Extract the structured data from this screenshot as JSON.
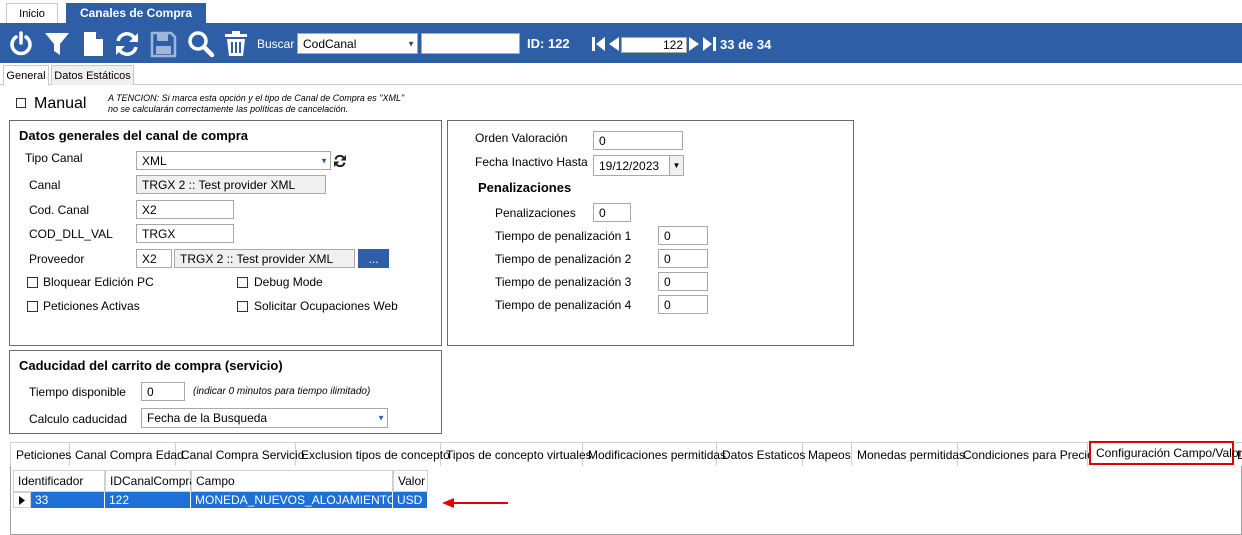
{
  "top_tabs": [
    "Inicio",
    "Canales de Compra"
  ],
  "toolbar": {
    "icons": [
      "power-icon",
      "filter-icon",
      "new-document-icon",
      "refresh-icon",
      "save-icon",
      "search-icon",
      "trash-icon"
    ],
    "search_label": "Buscar",
    "search_field": "CodCanal",
    "id_label": "ID: 122",
    "record_number": "122",
    "record_position": "33 de 34"
  },
  "sub_tabs": [
    "General",
    "Datos Estáticos"
  ],
  "manual": {
    "label": "Manual",
    "warning_line1": "A TENCION: Si marca esta opción y el tipo de Canal de Compra es \"XML\"",
    "warning_line2": "no se calcularán correctamente las políticas de cancelación."
  },
  "general": {
    "title": "Datos generales del canal de compra",
    "tipo_canal_label": "Tipo Canal",
    "tipo_canal_value": "XML",
    "canal_label": "Canal",
    "canal_value": "TRGX 2 :: Test provider XML",
    "cod_canal_label": "Cod. Canal",
    "cod_canal_value": "X2",
    "cod_dll_label": "COD_DLL_VAL",
    "cod_dll_value": "TRGX",
    "proveedor_label": "Proveedor",
    "proveedor_code": "X2",
    "proveedor_name": "TRGX 2 :: Test provider XML",
    "browse_label": "...",
    "bloquear_label": "Bloquear Edición PC",
    "debug_label": "Debug Mode",
    "peticiones_label": "Peticiones Activas",
    "solicitar_label": "Solicitar Ocupaciones Web"
  },
  "right_panel": {
    "orden_label": "Orden Valoración",
    "orden_value": "0",
    "fecha_label": "Fecha Inactivo Hasta",
    "fecha_value": "19/12/2023",
    "penalizaciones_title": "Penalizaciones",
    "penalizaciones_label": "Penalizaciones",
    "penalizaciones_value": "0",
    "tiempo1_label": "Tiempo de penalización 1",
    "tiempo1_value": "0",
    "tiempo2_label": "Tiempo de penalización 2",
    "tiempo2_value": "0",
    "tiempo3_label": "Tiempo de penalización 3",
    "tiempo3_value": "0",
    "tiempo4_label": "Tiempo de penalización 4",
    "tiempo4_value": "0"
  },
  "caducidad": {
    "title": "Caducidad del carrito de compra (servicio)",
    "tiempo_label": "Tiempo disponible",
    "tiempo_value": "0",
    "tiempo_hint": "(indicar 0 minutos para tiempo ilimitado)",
    "calculo_label": "Calculo caducidad",
    "calculo_value": "Fecha de la Busqueda"
  },
  "bottom_tabs": [
    "Peticiones",
    "Canal Compra Edad",
    "Canal Compra Servicio",
    "Exclusion tipos de concepto",
    "Tipos de concepto virtuales",
    "Modificaciones permitidas",
    "Datos Estaticos",
    "Mapeos",
    "Monedas permitidas",
    "Condiciones para Precios",
    "Configuración Campo/Valor",
    "L"
  ],
  "grid": {
    "columns": [
      "Identificador",
      "IDCanalCompra",
      "Campo",
      "Valor"
    ],
    "rows": [
      [
        "33",
        "122",
        "MONEDA_NUEVOS_ALOJAMIENTOS",
        "USD"
      ]
    ]
  },
  "colors": {
    "toolbar": "#2e5ea5",
    "selection": "#1e70d6",
    "highlight": "#e00000"
  }
}
